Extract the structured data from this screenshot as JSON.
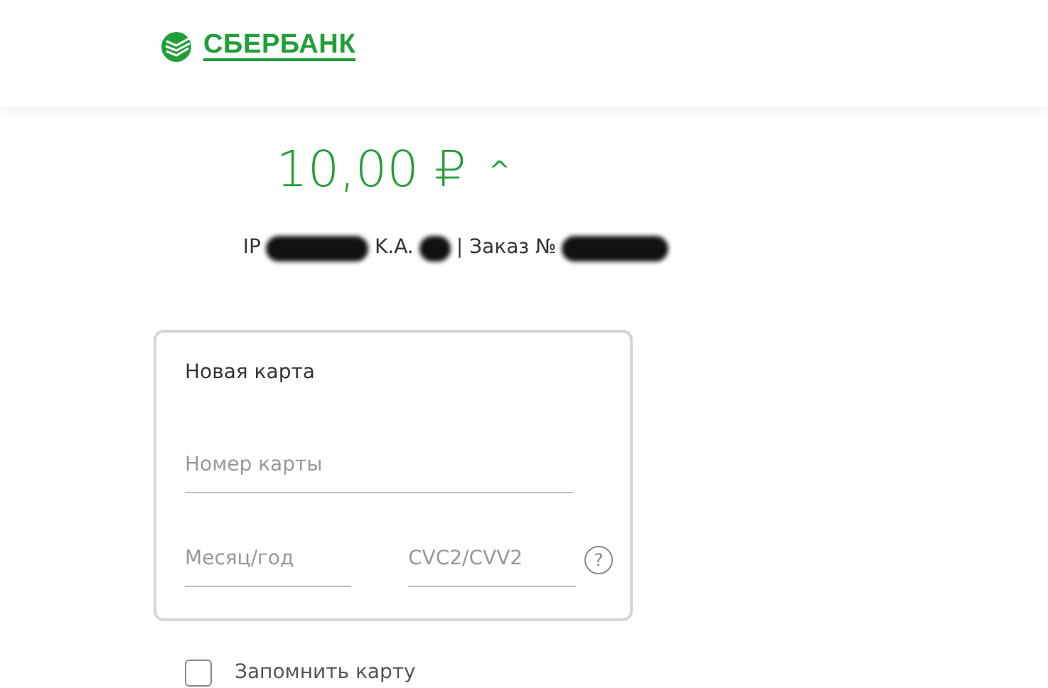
{
  "header": {
    "logo_text": "СБЕРБАНК"
  },
  "amount": {
    "value": "10,00 ₽",
    "toggle": "^"
  },
  "merchant_line": [
    {
      "kind": "text",
      "text": "IP"
    },
    {
      "kind": "redacted"
    },
    {
      "kind": "text",
      "text": "K.A."
    },
    {
      "kind": "redacted"
    },
    {
      "kind": "text",
      "text": "| Заказ №"
    },
    {
      "kind": "redacted"
    }
  ],
  "card_form": {
    "title": "Новая карта",
    "fields": [
      {
        "kind": "number",
        "placeholder": "Номер карты"
      },
      {
        "kind": "expiry",
        "placeholder": "Месяц/год"
      },
      {
        "kind": "cvc",
        "placeholder": "CVC2/CVV2",
        "help": "?"
      }
    ]
  },
  "remember": {
    "label": "Запомнить карту",
    "checked": false
  }
}
